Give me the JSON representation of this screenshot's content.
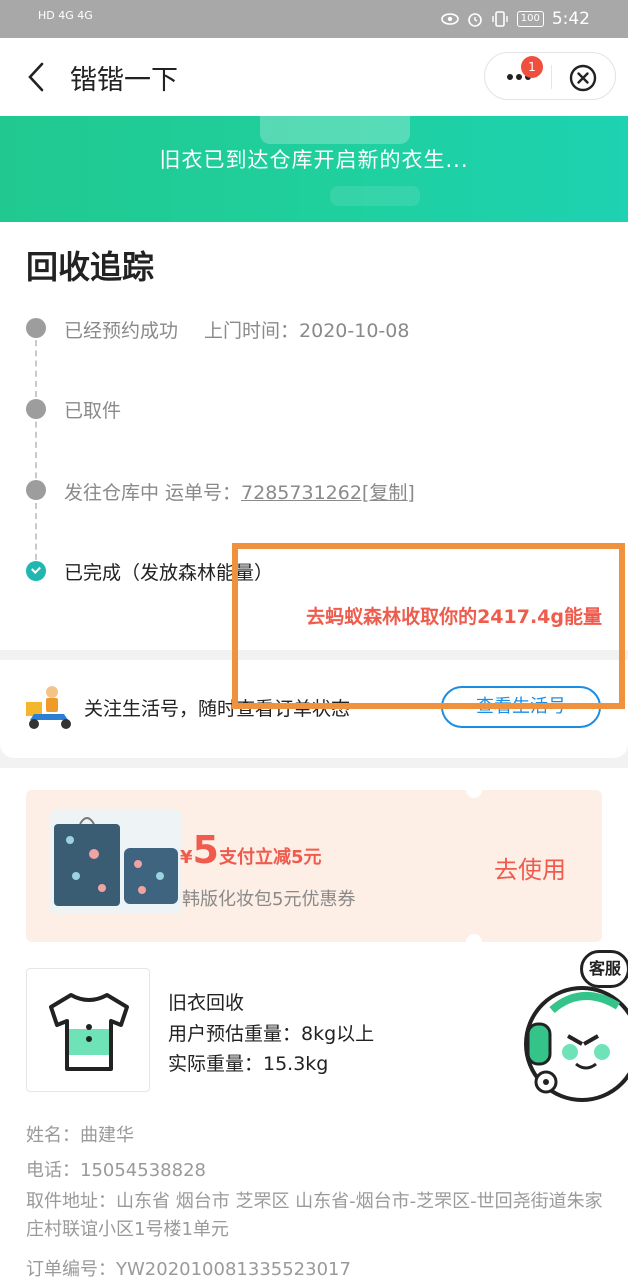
{
  "status_bar": {
    "left_text": "HD 4G 4G",
    "battery": "100",
    "time": "5:42"
  },
  "nav": {
    "title": "锴锴一下",
    "badge": "1"
  },
  "banner": {
    "text": "旧衣已到达仓库开启新的衣生..."
  },
  "tracking": {
    "title": "回收追踪",
    "steps": [
      {
        "label": "已经预约成功",
        "extra": "上门时间：2020-10-08"
      },
      {
        "label": "已取件"
      },
      {
        "label": "发往仓库中 运单号：",
        "waybill": "7285731262[复制]"
      },
      {
        "label": "已完成（发放森林能量）"
      }
    ],
    "forest_text": "去蚂蚁森林收取你的2417.4g能量"
  },
  "follow": {
    "text": "关注生活号，随时查看订单状态",
    "button": "查看生活号"
  },
  "coupon": {
    "yen": "¥",
    "amount": "5",
    "amount_text": "支付立减5元",
    "desc": "韩版化妆包5元优惠券",
    "use": "去使用"
  },
  "product": {
    "name": "旧衣回收",
    "estimated": "用户预估重量：8kg以上",
    "actual": "实际重量：15.3kg"
  },
  "order": {
    "name": "姓名：曲建华",
    "phone": "电话：15054538828",
    "address": "取件地址：山东省 烟台市 芝罘区 山东省-烟台市-芝罘区-世回尧街道朱家庄村联谊小区1号楼1单元",
    "order_no": "订单编号：YW202010081335523017"
  },
  "service": {
    "label": "客服"
  },
  "colors": {
    "brand_green": "#21c990",
    "accent_red": "#ef5c4d",
    "link_blue": "#1b8de5",
    "highlight_orange": "#f0913e"
  }
}
